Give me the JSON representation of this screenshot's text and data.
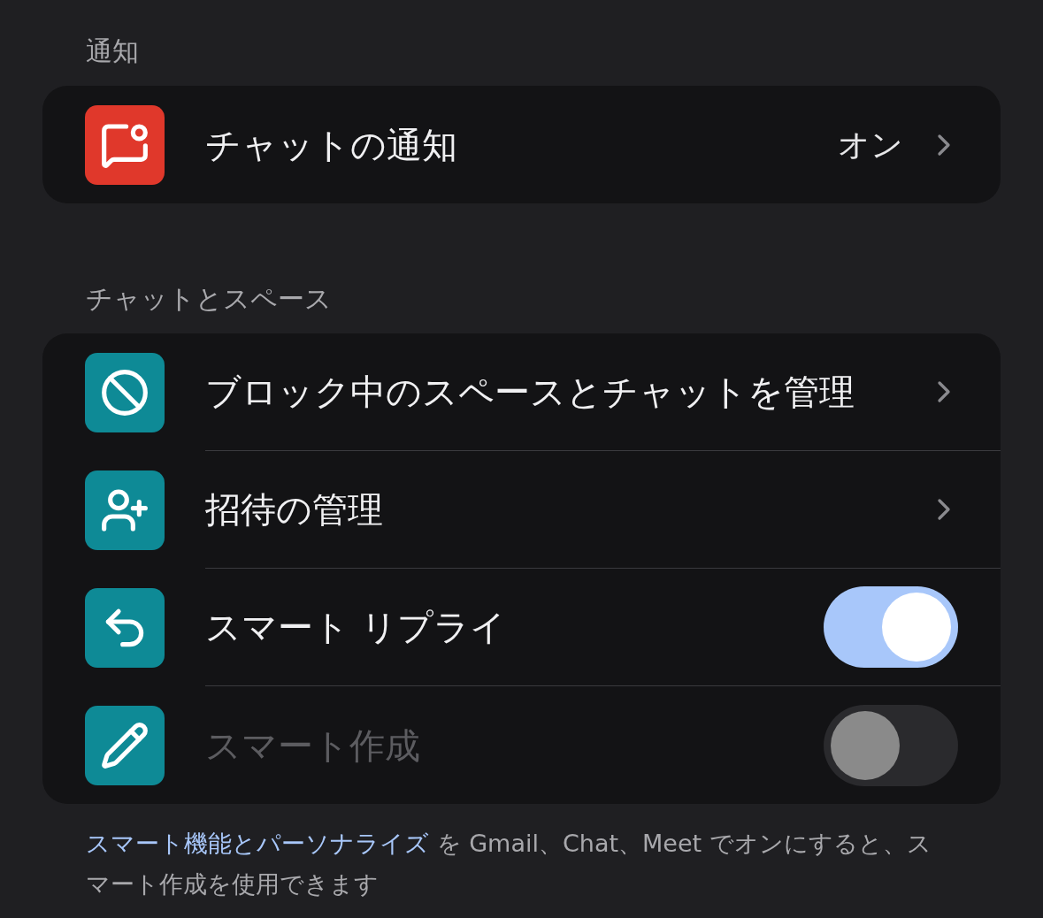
{
  "sections": [
    {
      "header": "通知",
      "rows": [
        {
          "kind": "link",
          "color": "#e0382b",
          "label": "チャットの通知",
          "value": "オン",
          "disabled": false
        }
      ]
    },
    {
      "header": "チャットとスペース",
      "rows": [
        {
          "kind": "link",
          "color": "#0e8a96",
          "label": "ブロック中のスペースとチャットを管理",
          "disabled": false
        },
        {
          "kind": "link",
          "color": "#0e8a96",
          "label": "招待の管理",
          "disabled": false
        },
        {
          "kind": "toggle",
          "color": "#0e8a96",
          "label": "スマート リプライ",
          "on": true,
          "disabled": false
        },
        {
          "kind": "toggle",
          "color": "#0e8a96",
          "label": "スマート作成",
          "on": false,
          "disabled": true
        }
      ]
    }
  ],
  "footer": {
    "link": "スマート機能とパーソナライズ",
    "text": " を Gmail、Chat、Meet でオンにすると、スマート作成を使用できます"
  }
}
